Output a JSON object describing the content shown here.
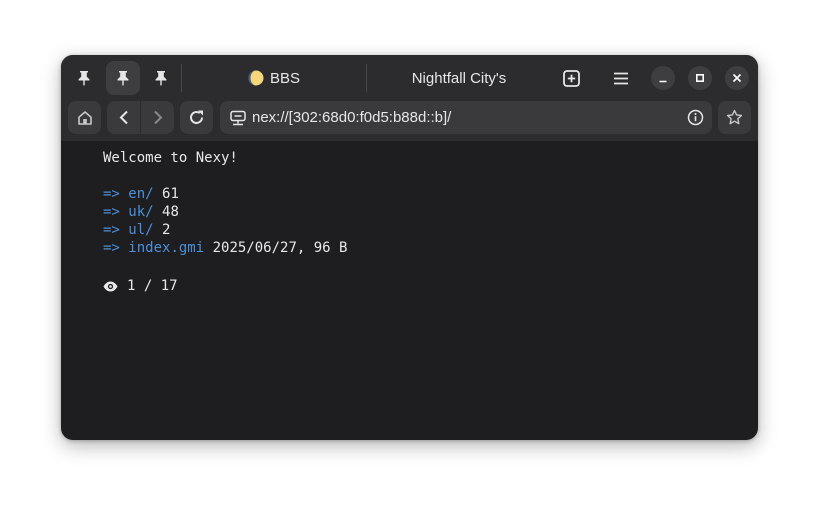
{
  "tabs": [
    {
      "label": "BBS",
      "icon": "moon-icon"
    },
    {
      "label": "Nightfall City's"
    }
  ],
  "pinned_tabs": [
    "pin-icon",
    "pin-icon",
    "pin-icon"
  ],
  "address_bar": {
    "url": "nex://[302:68d0:f0d5:b88d::b]/"
  },
  "page": {
    "welcome": "Welcome to Nexy!",
    "links": [
      {
        "arrow": "=>",
        "href": "en/",
        "note": "61"
      },
      {
        "arrow": "=>",
        "href": "uk/",
        "note": "48"
      },
      {
        "arrow": "=>",
        "href": "ul/",
        "note": "2"
      },
      {
        "arrow": "=>",
        "href": "index.gmi",
        "note": "2025/06/27, 96 B"
      }
    ],
    "counter": "1 / 17"
  },
  "colors": {
    "window_bg": "#1e1e20",
    "header_bg": "#2c2c2e",
    "link": "#4a90d9",
    "text": "#e8e8e8"
  }
}
